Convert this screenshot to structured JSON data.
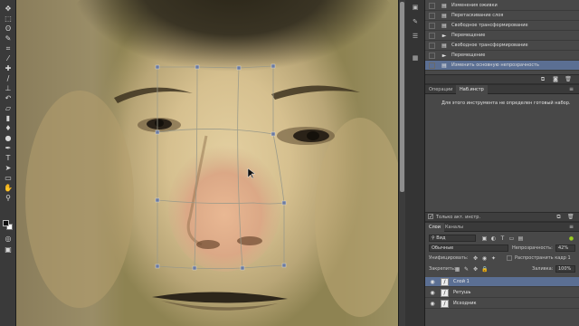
{
  "toolbar": {
    "tools": [
      {
        "name": "move-icon",
        "glyph": "✥"
      },
      {
        "name": "marquee-icon",
        "glyph": "⬚"
      },
      {
        "name": "lasso-icon",
        "glyph": "ʘ"
      },
      {
        "name": "quick-select-icon",
        "glyph": "✎"
      },
      {
        "name": "crop-icon",
        "glyph": "⌗"
      },
      {
        "name": "eyedropper-icon",
        "glyph": "⁄"
      },
      {
        "name": "healing-brush-icon",
        "glyph": "✚"
      },
      {
        "name": "brush-icon",
        "glyph": "∕"
      },
      {
        "name": "clone-stamp-icon",
        "glyph": "⊥"
      },
      {
        "name": "history-brush-icon",
        "glyph": "↶"
      },
      {
        "name": "eraser-icon",
        "glyph": "▱"
      },
      {
        "name": "gradient-icon",
        "glyph": "▮"
      },
      {
        "name": "blur-icon",
        "glyph": "♦"
      },
      {
        "name": "dodge-icon",
        "glyph": "●"
      },
      {
        "name": "pen-icon",
        "glyph": "✒"
      },
      {
        "name": "type-icon",
        "glyph": "T"
      },
      {
        "name": "path-selection-icon",
        "glyph": "➤"
      },
      {
        "name": "rectangle-icon",
        "glyph": "▭"
      },
      {
        "name": "hand-icon",
        "glyph": "✋"
      },
      {
        "name": "zoom-icon",
        "glyph": "⚲"
      }
    ],
    "extra": [
      {
        "name": "quick-mask-icon",
        "glyph": "◎"
      },
      {
        "name": "screen-mode-icon",
        "glyph": "▣"
      }
    ]
  },
  "history": {
    "items": [
      {
        "label": "Изменения оживки",
        "icon": "▤",
        "active": false
      },
      {
        "label": "Перетаскивание слоя",
        "icon": "▤",
        "active": false
      },
      {
        "label": "Свободное трансформирование",
        "icon": "▤",
        "active": false
      },
      {
        "label": "Перемещение",
        "icon": "►",
        "active": false
      },
      {
        "label": "Свободное трансформирование",
        "icon": "▤",
        "active": false
      },
      {
        "label": "Перемещение",
        "icon": "►",
        "active": false
      },
      {
        "label": "Изменить основную непрозрачность",
        "icon": "▤",
        "active": true
      }
    ],
    "footer_icons": [
      "new-document-from-state-icon",
      "camera-icon",
      "delete-state-icon"
    ]
  },
  "operations": {
    "tabs": [
      {
        "label": "Операции",
        "active": false
      },
      {
        "label": "Наб.инстр",
        "active": true
      }
    ],
    "message": "Для этого инструмента не определен готовый набор.",
    "checkbox_label": "Только акт. инстр."
  },
  "layers": {
    "tabs": [
      {
        "label": "Слои",
        "active": true
      },
      {
        "label": "Каналы",
        "active": false
      }
    ],
    "filter_label": "Вид",
    "blend_mode": "Обычные",
    "opacity_label": "Непрозрачность:",
    "opacity_value": "42%",
    "unify_label": "Унифицировать:",
    "propagate_label": "Распространить кадр 1",
    "lock_label": "Закрепить:",
    "fill_label": "Заливка:",
    "fill_value": "100%",
    "items": [
      {
        "name": "Слой 1",
        "active": true
      },
      {
        "name": "Ретушь",
        "active": false
      },
      {
        "name": "Исходник",
        "active": false
      }
    ]
  },
  "colors": {
    "selection": "#5b6f93",
    "panel": "#484848",
    "toolbar": "#3a3a3a"
  }
}
